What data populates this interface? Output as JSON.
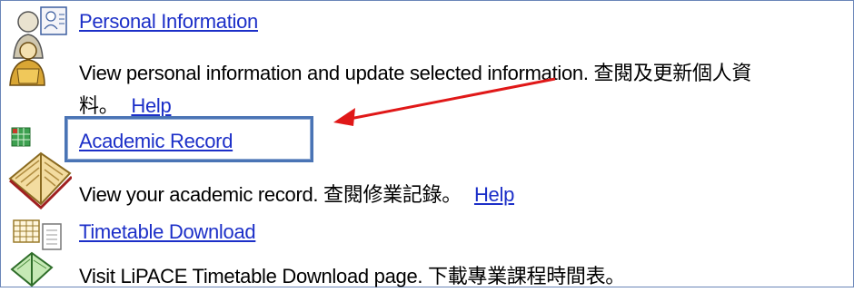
{
  "items": [
    {
      "title": "Personal Information",
      "desc_line1": "View personal information and update selected information. 查閱及更新個人資",
      "desc_line2": "料。",
      "help": "Help",
      "icon": "people-icon"
    },
    {
      "title": "Academic Record",
      "desc": "View your academic record. 查閱修業記錄。",
      "help": "Help",
      "icon": "open-book-icon"
    },
    {
      "title": "Timetable Download",
      "desc": "Visit LiPACE Timetable Download page. 下載專業課程時間表。",
      "icon": "calendar-download-icon"
    }
  ],
  "annotation": {
    "highlight_color": "#4a74b5",
    "arrow_color": "#e01818"
  }
}
